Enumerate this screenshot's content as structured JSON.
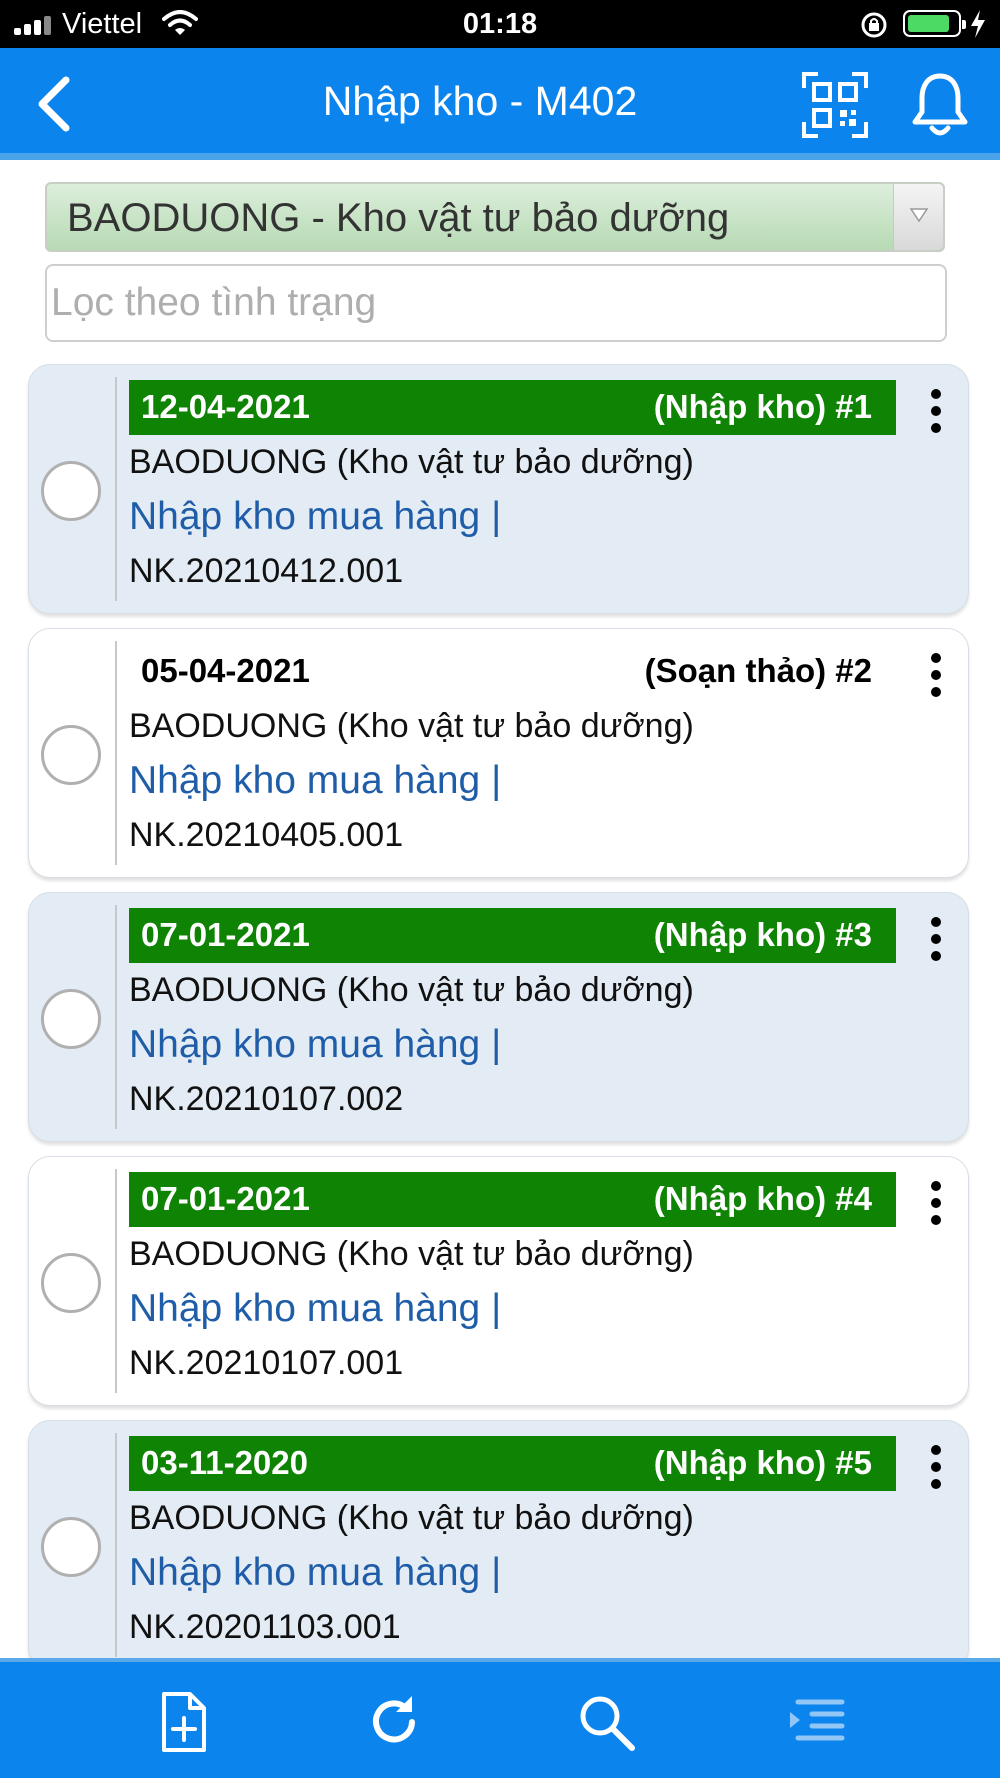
{
  "status_bar": {
    "carrier": "Viettel",
    "time": "01:18",
    "battery_level": 0.85
  },
  "header": {
    "title": "Nhập kho - M402",
    "back_icon": "back-chevron-icon",
    "qr_icon": "qr-scan-icon",
    "bell_icon": "bell-icon"
  },
  "filters": {
    "warehouse": "BAODUONG - Kho vật tư bảo dưỡng",
    "status_placeholder": "Lọc theo tình trạng",
    "status_value": ""
  },
  "records": [
    {
      "date": "12-04-2021",
      "status": "(Nhập kho) #1",
      "warehouse": "BAODUONG (Kho vật tư bảo dưỡng)",
      "type": "Nhập kho mua hàng |",
      "code": "NK.20210412.001"
    },
    {
      "date": "05-04-2021",
      "status": "(Soạn thảo) #2",
      "warehouse": "BAODUONG (Kho vật tư bảo dưỡng)",
      "type": "Nhập kho mua hàng |",
      "code": "NK.20210405.001"
    },
    {
      "date": "07-01-2021",
      "status": "(Nhập kho) #3",
      "warehouse": "BAODUONG (Kho vật tư bảo dưỡng)",
      "type": "Nhập kho mua hàng |",
      "code": "NK.20210107.002"
    },
    {
      "date": "07-01-2021",
      "status": "(Nhập kho) #4",
      "warehouse": "BAODUONG (Kho vật tư bảo dưỡng)",
      "type": "Nhập kho mua hàng |",
      "code": "NK.20210107.001"
    },
    {
      "date": "03-11-2020",
      "status": "(Nhập kho) #5",
      "warehouse": "BAODUONG (Kho vật tư bảo dưỡng)",
      "type": "Nhập kho mua hàng |",
      "code": "NK.20201103.001"
    }
  ],
  "toolbar": {
    "icons": [
      "new-document-icon",
      "refresh-icon",
      "search-icon",
      "list-menu-icon"
    ]
  },
  "colors": {
    "primary": "#0b84ee",
    "posted_header": "#0f8404",
    "link_text": "#1f5da8",
    "card_shaded": "#e3ecf4"
  }
}
